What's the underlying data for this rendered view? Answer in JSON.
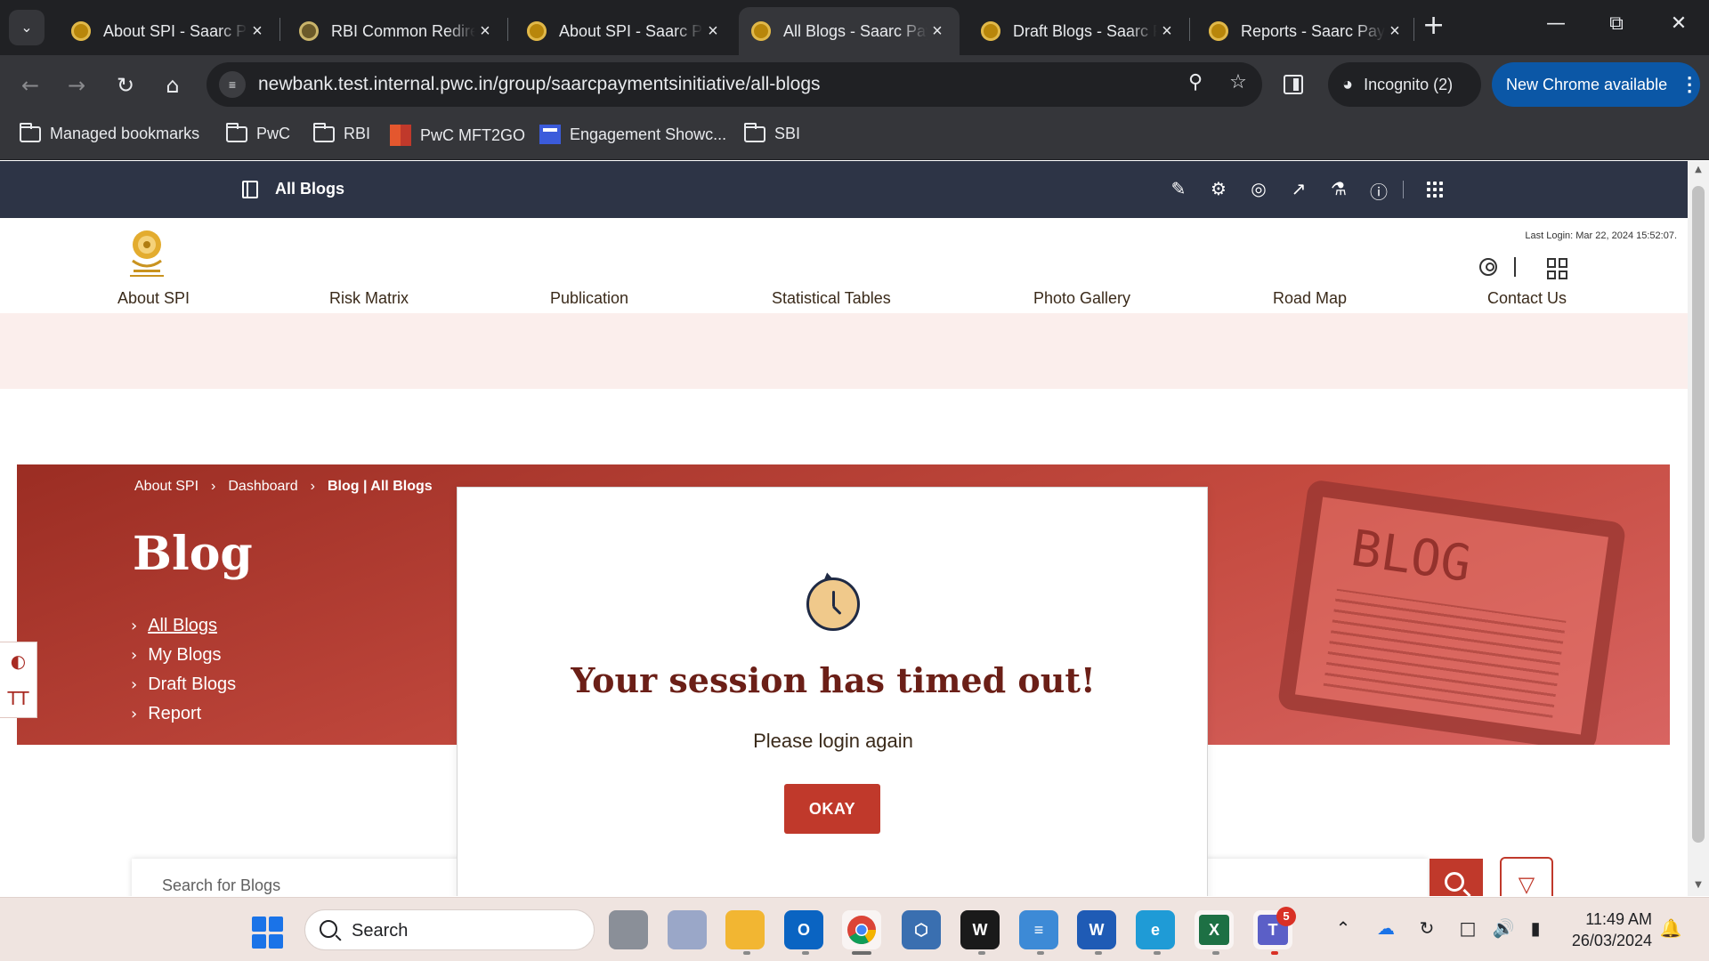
{
  "browser": {
    "tabs": [
      {
        "title": "About SPI - Saarc Payments Initiative",
        "active": false
      },
      {
        "title": "RBI Common Redirect",
        "active": false
      },
      {
        "title": "About SPI - Saarc Payments Initiative",
        "active": false
      },
      {
        "title": "All Blogs - Saarc Payments Initiative",
        "active": true
      },
      {
        "title": "Draft Blogs - Saarc Payments Initiative",
        "active": false
      },
      {
        "title": "Reports - Saarc Payments Initiative",
        "active": false
      }
    ],
    "url_host": "newbank.test.internal.pwc.in",
    "url_path": "/group/saarcpaymentsinitiative/all-blogs",
    "incognito_label": "Incognito (2)",
    "update_label": "New Chrome available",
    "bookmarks": [
      "Managed bookmarks",
      "PwC",
      "RBI",
      "PwC MFT2GO",
      "Engagement Showc...",
      "SBI"
    ]
  },
  "adminbar": {
    "title": "All Blogs"
  },
  "site": {
    "last_login": "Last Login: Mar 22, 2024 15:52:07.",
    "menu": [
      "About SPI",
      "Risk Matrix",
      "Publication",
      "Statistical Tables",
      "Photo Gallery",
      "Road Map",
      "Contact Us"
    ]
  },
  "hero": {
    "breadcrumb": [
      "About SPI",
      "Dashboard",
      "Blog | All Blogs"
    ],
    "title": "Blog",
    "laptop_text": "BLOG",
    "links": [
      {
        "label": "All Blogs",
        "active": true
      },
      {
        "label": "My Blogs",
        "active": false
      },
      {
        "label": "Draft Blogs",
        "active": false
      },
      {
        "label": "Report",
        "active": false
      }
    ]
  },
  "side_tools": {
    "text_size_label": "TT"
  },
  "search": {
    "placeholder": "Search for Blogs"
  },
  "modal": {
    "title": "Your session has timed out!",
    "message": "Please login again",
    "button_label": "OKAY"
  },
  "taskbar": {
    "search_label": "Search",
    "teams_badge": "5",
    "time": "11:49 AM",
    "date": "26/03/2024"
  },
  "colors": {
    "brand_red": "#c0392b",
    "admin_bar": "#2d3446",
    "modal_title": "#6b1f17"
  }
}
